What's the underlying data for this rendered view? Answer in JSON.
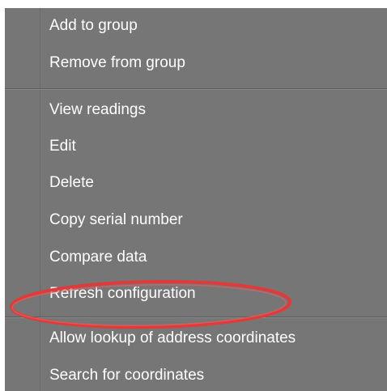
{
  "menu": {
    "group1": [
      {
        "label": "Add to group"
      },
      {
        "label": "Remove from group"
      }
    ],
    "group2": [
      {
        "label": "View readings"
      },
      {
        "label": "Edit"
      },
      {
        "label": "Delete"
      },
      {
        "label": "Copy serial number"
      },
      {
        "label": "Compare data"
      },
      {
        "label": "Refresh configuration"
      }
    ],
    "group3": [
      {
        "label": "Allow lookup of address coordinates"
      },
      {
        "label": "Search for coordinates"
      }
    ]
  },
  "highlight": {
    "target": "Refresh configuration",
    "color": "#e03a3a"
  },
  "colors": {
    "menu_background": "#767676",
    "text": "#ffffff"
  }
}
